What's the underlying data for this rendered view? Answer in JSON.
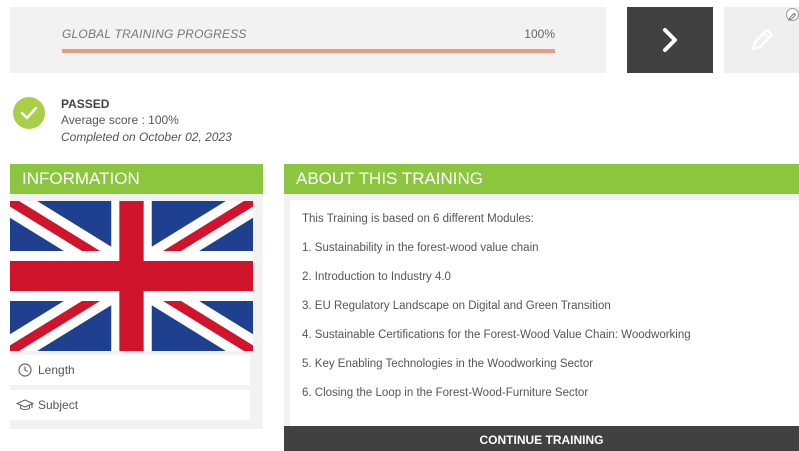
{
  "progress": {
    "label": "GLOBAL TRAINING PROGRESS",
    "value_text": "100%",
    "fraction": 1.0
  },
  "toolbar": {
    "next_icon": "chevron-right-icon",
    "edit_icon": "pencil-icon"
  },
  "status": {
    "title": "PASSED",
    "score": "Average score : 100%",
    "completed": "Completed on October 02, 2023"
  },
  "information": {
    "header": "INFORMATION",
    "flag_icon": "uk-flag",
    "rows": [
      {
        "label": "Length",
        "icon": "clock-icon"
      },
      {
        "label": "Subject",
        "icon": "graduation-cap-icon"
      }
    ]
  },
  "about": {
    "header": "ABOUT THIS TRAINING",
    "intro": "This Training is based on 6 different Modules:",
    "modules": [
      "1. Sustainability in the forest-wood value chain",
      "2. Introduction to Industry 4.0",
      "3. EU Regulatory Landscape on Digital and Green Transition",
      "4. Sustainable Certifications for the Forest-Wood Value Chain: Woodworking",
      "5. Key Enabling Technologies in the Woodworking Sector",
      "6. Closing the Loop in the Forest-Wood-Furniture Sector"
    ],
    "continue_label": "CONTINUE TRAINING"
  },
  "colors": {
    "accent_green": "#8cc63f",
    "progress_fill": "#e89b83",
    "dark_button": "#414141"
  }
}
